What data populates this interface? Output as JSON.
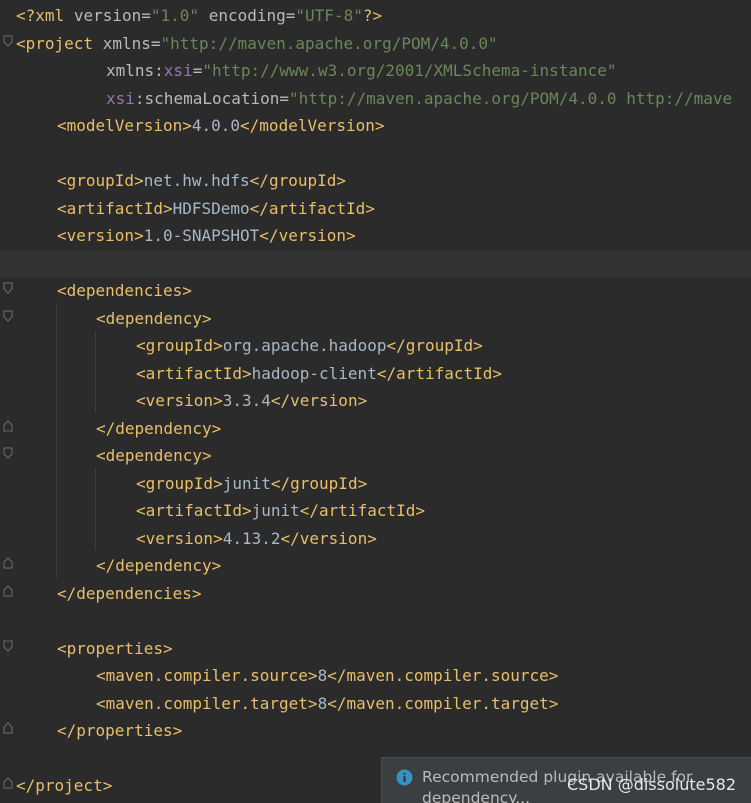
{
  "editor": {
    "file_type": "xml",
    "lines": {
      "l1": {
        "open": "<?xml",
        "attr1": "version",
        "eq1": "=",
        "val1": "\"1.0\"",
        "attr2": "encoding",
        "eq2": "=",
        "val2": "\"UTF-8\"",
        "close": "?>"
      },
      "l2": {
        "open": "<project",
        "attr": "xmlns",
        "eq": "=",
        "val": "\"http://maven.apache.org/POM/4.0.0\""
      },
      "l3": {
        "attr": "xmlns:",
        "ns": "xsi",
        "eq": "=",
        "val": "\"http://www.w3.org/2001/XMLSchema-instance\""
      },
      "l4": {
        "ns": "xsi",
        "attr": ":schemaLocation",
        "eq": "=",
        "val": "\"http://maven.apache.org/POM/4.0.0 http://mave"
      },
      "l5": {
        "open": "<modelVersion>",
        "text": "4.0.0",
        "close": "</modelVersion>"
      },
      "l7": {
        "open": "<groupId>",
        "text": "net.hw.hdfs",
        "close": "</groupId>"
      },
      "l8": {
        "open": "<artifactId>",
        "text": "HDFSDemo",
        "close": "</artifactId>"
      },
      "l9": {
        "open": "<version>",
        "text": "1.0-SNAPSHOT",
        "close": "</version>"
      },
      "l11": {
        "open": "<dependencies>"
      },
      "l12": {
        "open": "<dependency>"
      },
      "l13": {
        "open": "<groupId>",
        "text": "org.apache.hadoop",
        "close": "</groupId>"
      },
      "l14": {
        "open": "<artifactId>",
        "text": "hadoop-client",
        "close": "</artifactId>"
      },
      "l15": {
        "open": "<version>",
        "text": "3.3.4",
        "close": "</version>"
      },
      "l16": {
        "close": "</dependency>"
      },
      "l17": {
        "open": "<dependency>"
      },
      "l18": {
        "open": "<groupId>",
        "text": "junit",
        "close": "</groupId>"
      },
      "l19": {
        "open": "<artifactId>",
        "text": "junit",
        "close": "</artifactId>"
      },
      "l20": {
        "open": "<version>",
        "text": "4.13.2",
        "close": "</version>"
      },
      "l21": {
        "close": "</dependency>"
      },
      "l22": {
        "close": "</dependencies>"
      },
      "l24": {
        "open": "<properties>"
      },
      "l25": {
        "open": "<maven.compiler.source>",
        "text": "8",
        "close": "</maven.compiler.source>"
      },
      "l26": {
        "open": "<maven.compiler.target>",
        "text": "8",
        "close": "</maven.compiler.target>"
      },
      "l27": {
        "close": "</properties>"
      },
      "l29": {
        "close": "</project>"
      }
    }
  },
  "notification": {
    "icon": "info-icon",
    "message": "Recommended plugin available for dependency..."
  },
  "watermark": "CSDN @dissolute582",
  "colors": {
    "background": "#2b2b2b",
    "tag": "#e8bf6a",
    "attribute": "#bababa",
    "namespace": "#9876aa",
    "string": "#6a8759",
    "text": "#a9b7c6",
    "notification_bg": "#3c3f41",
    "info_accent": "#3592c4"
  }
}
